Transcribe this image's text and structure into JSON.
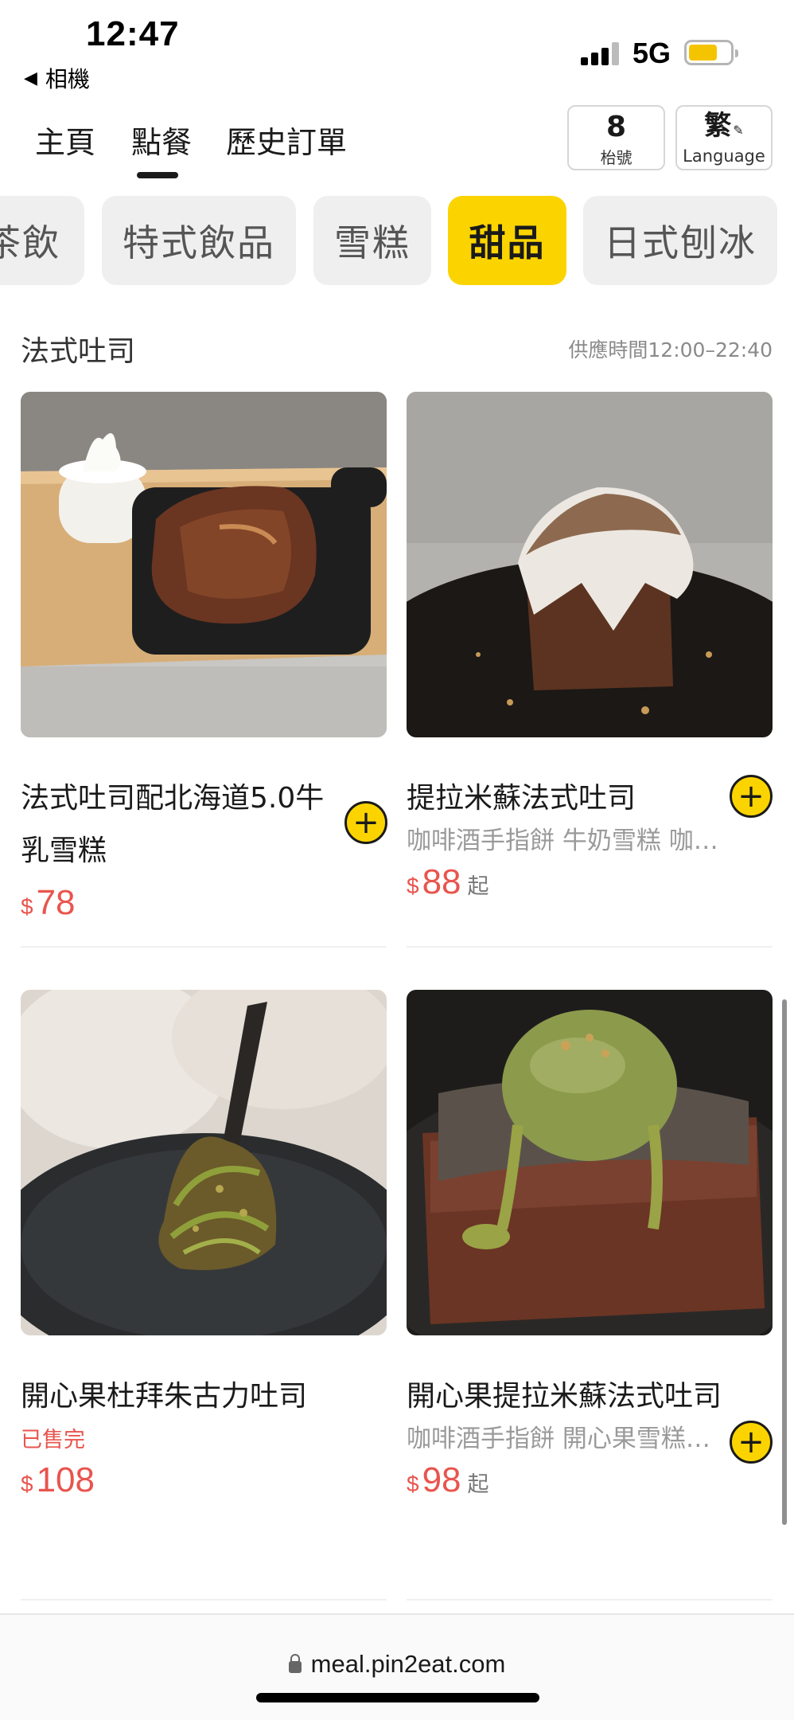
{
  "status_bar": {
    "time": "12:47",
    "back_label": "相機",
    "network": "5G"
  },
  "nav": {
    "tabs": [
      "主頁",
      "點餐",
      "歷史訂單"
    ],
    "active_tab": "點餐",
    "table": {
      "number": "8",
      "label": "枱號"
    },
    "language": {
      "char": "繁",
      "label": "Language"
    }
  },
  "categories": {
    "items": [
      "茶飲",
      "特式飲品",
      "雪糕",
      "甜品",
      "日式刨冰"
    ],
    "active": "甜品"
  },
  "section": {
    "title": "法式吐司",
    "hours": "供應時間12:00–22:40"
  },
  "products": [
    {
      "name": "法式吐司配北海道5.0牛乳雪糕",
      "desc": "",
      "status": "",
      "currency": "$",
      "price": "78",
      "from": ""
    },
    {
      "name": "提拉米蘇法式吐司",
      "desc": "咖啡酒手指餅 牛奶雪糕 咖啡…",
      "status": "",
      "currency": "$",
      "price": "88",
      "from": "起"
    },
    {
      "name": "開心果杜拜朱古力吐司",
      "desc": "",
      "status": "已售完",
      "currency": "$",
      "price": "108",
      "from": ""
    },
    {
      "name": "開心果提拉米蘇法式吐司",
      "desc": "咖啡酒手指餅 開心果雪糕…",
      "status": "",
      "currency": "$",
      "price": "98",
      "from": "起"
    }
  ],
  "add_symbol": "+",
  "browser": {
    "url": "meal.pin2eat.com"
  },
  "colors": {
    "accent": "#fbd400",
    "price": "#e8554e",
    "muted": "#9a9a9a"
  }
}
